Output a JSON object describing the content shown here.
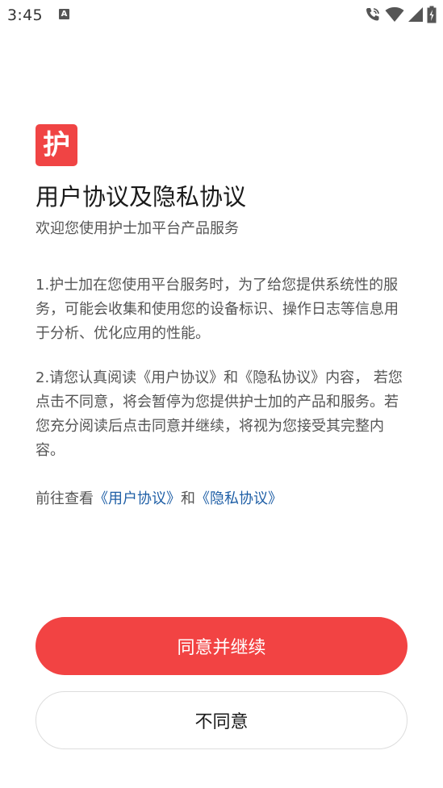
{
  "status_bar": {
    "time": "3:45",
    "notification_icon": "a-icon",
    "icons": [
      "wifi-call-icon",
      "wifi-icon",
      "signal-icon",
      "battery-icon"
    ]
  },
  "logo": {
    "char": "护",
    "color": "#f04444"
  },
  "title": "用户协议及隐私协议",
  "subtitle": "欢迎您使用护士加平台产品服务",
  "paragraphs": [
    "1.护士加在您使用平台服务时，为了给您提供系统性的服务，可能会收集和使用您的设备标识、操作日志等信息用于分析、优化应用的性能。",
    "2.请您认真阅读《用户协议》和《隐私协议》内容， 若您点击不同意，将会暂停为您提供护士加的产品和服务。若您充分阅读后点击同意并继续，将视为您接受其完整内容。"
  ],
  "links_line": {
    "prefix": "前往查看",
    "user_agreement": "《用户协议》",
    "conjunction": "和",
    "privacy_agreement": "《隐私协议》"
  },
  "buttons": {
    "agree": "同意并继续",
    "disagree": "不同意"
  },
  "colors": {
    "accent": "#f24343",
    "link": "#1f5fa6"
  }
}
